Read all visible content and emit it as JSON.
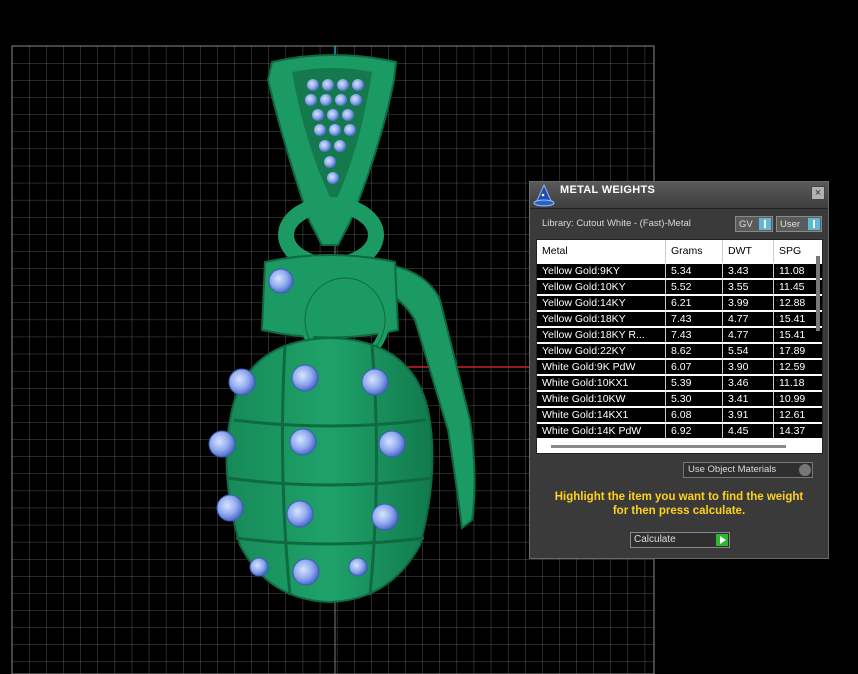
{
  "window": {
    "title": "METAL WEIGHTS",
    "close_label": "×",
    "icon": "wizard-hat-icon"
  },
  "library": {
    "label": "Library: Cutout White - (Fast)-Metal",
    "toggle_gv": "GV",
    "toggle_user": "User"
  },
  "table": {
    "columns": [
      "Metal",
      "Grams",
      "DWT",
      "SPG"
    ],
    "rows": [
      [
        "Yellow Gold:9KY",
        "5.34",
        "3.43",
        "11.08"
      ],
      [
        "Yellow Gold:10KY",
        "5.52",
        "3.55",
        "11.45"
      ],
      [
        "Yellow Gold:14KY",
        "6.21",
        "3.99",
        "12.88"
      ],
      [
        "Yellow Gold:18KY",
        "7.43",
        "4.77",
        "15.41"
      ],
      [
        "Yellow Gold:18KY R...",
        "7.43",
        "4.77",
        "15.41"
      ],
      [
        "Yellow Gold:22KY",
        "8.62",
        "5.54",
        "17.89"
      ],
      [
        "White Gold:9K PdW",
        "6.07",
        "3.90",
        "12.59"
      ],
      [
        "White Gold:10KX1",
        "5.39",
        "3.46",
        "11.18"
      ],
      [
        "White Gold:10KW",
        "5.30",
        "3.41",
        "10.99"
      ],
      [
        "White Gold:14KX1",
        "6.08",
        "3.91",
        "12.61"
      ],
      [
        "White Gold:14K PdW",
        "6.92",
        "4.45",
        "14.37"
      ]
    ]
  },
  "materials_dropdown": "Use Object Materials",
  "instruction": {
    "line1": "Highlight the item you want to find the weight",
    "line2": "for then press calculate."
  },
  "calculate_label": "Calculate",
  "colors": {
    "model": "#1e8a5c",
    "gem": "#8fb0f0",
    "grid": "#7a7a7a",
    "instruction": "#ffd21f"
  }
}
